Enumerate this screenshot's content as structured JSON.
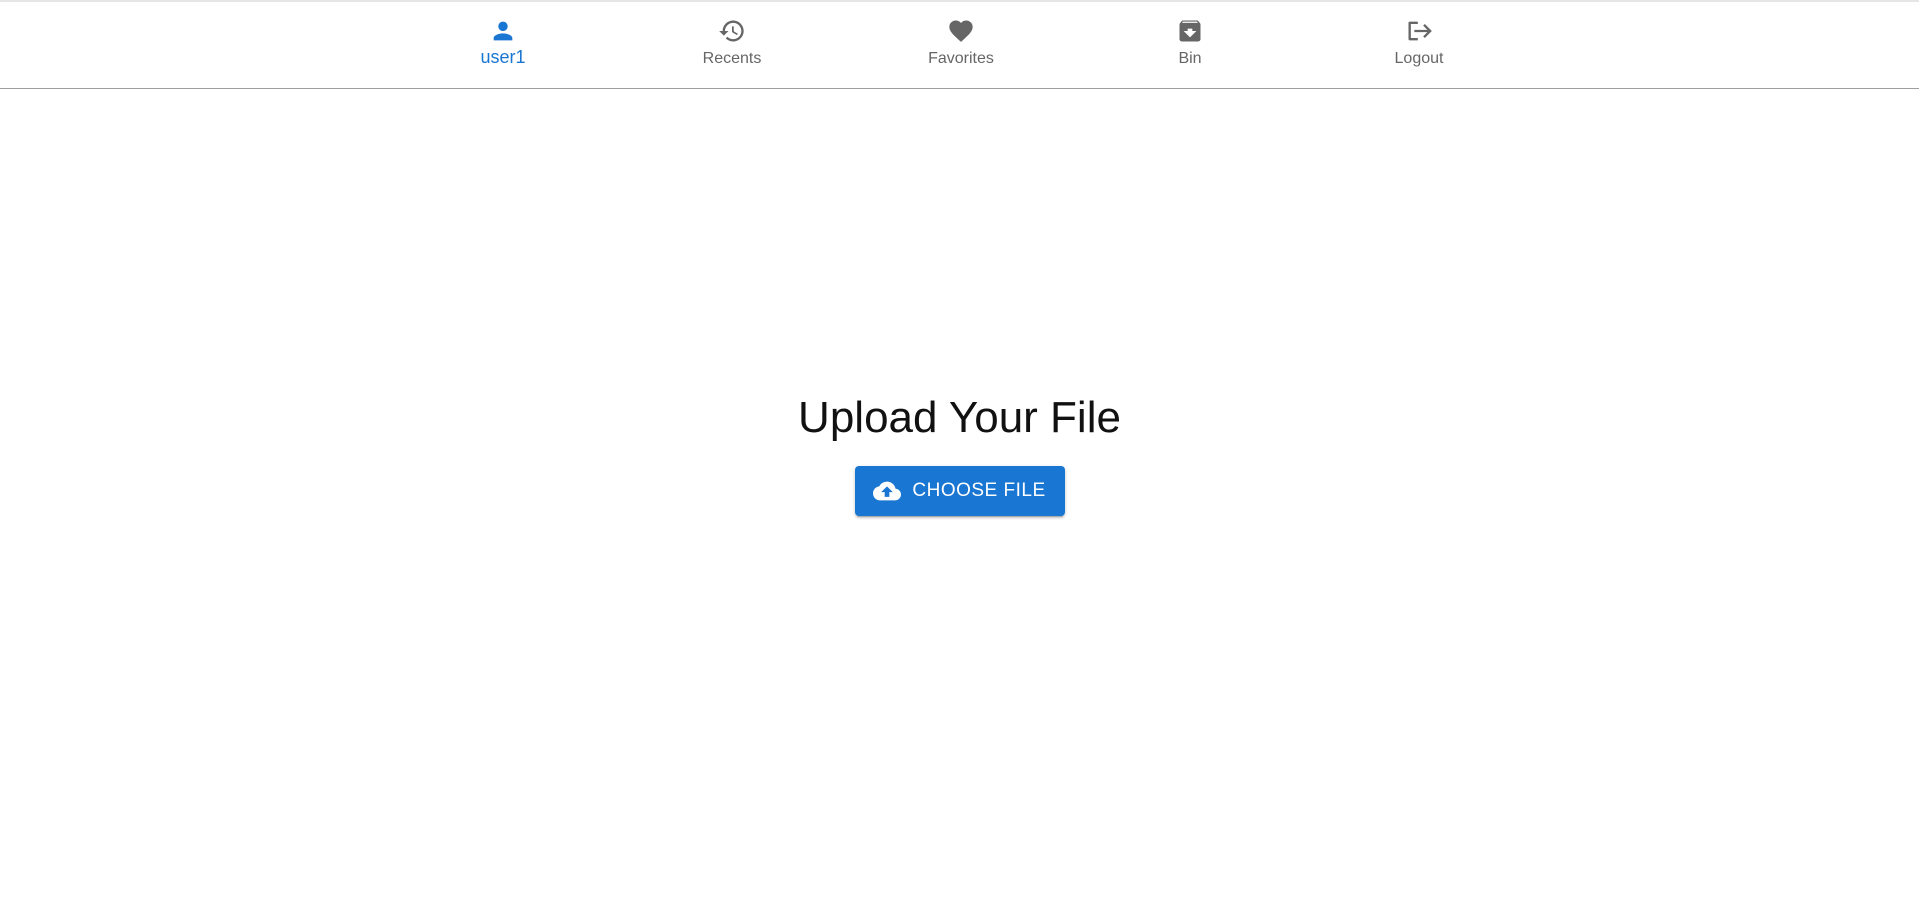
{
  "colors": {
    "accent": "#1976d2",
    "nav_inactive": "#666666",
    "background": "#ffffff"
  },
  "nav": {
    "items": [
      {
        "label": "user1",
        "icon": "person-icon",
        "active": true
      },
      {
        "label": "Recents",
        "icon": "history-icon",
        "active": false
      },
      {
        "label": "Favorites",
        "icon": "heart-icon",
        "active": false
      },
      {
        "label": "Bin",
        "icon": "archive-icon",
        "active": false
      },
      {
        "label": "Logout",
        "icon": "logout-icon",
        "active": false
      }
    ]
  },
  "main": {
    "title": "Upload Your File",
    "upload_button": {
      "label": "CHOOSE FILE",
      "icon": "cloud-upload-icon"
    }
  }
}
